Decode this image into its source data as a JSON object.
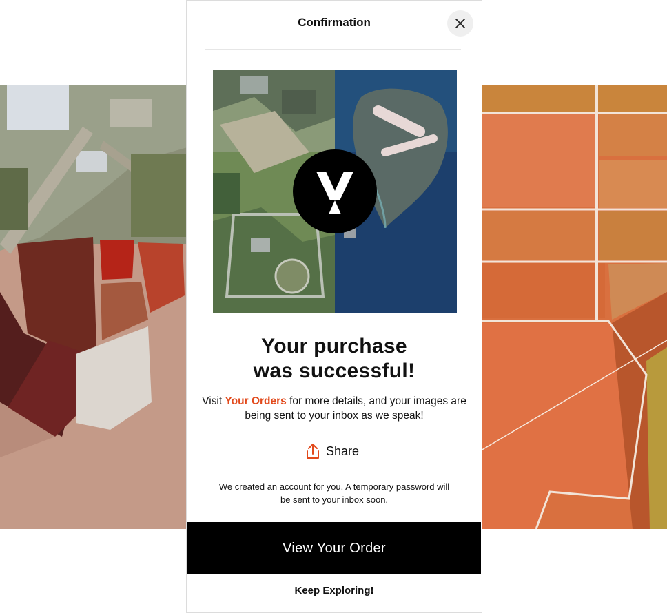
{
  "modal": {
    "title": "Confirmation",
    "close_icon": "close-icon",
    "hero_logo_icon": "brand-logo-icon",
    "headline_line1": "Your purchase",
    "headline_line2": "was successful!",
    "subtext_before": "Visit ",
    "subtext_link": "Your Orders",
    "subtext_after": " for more details, and your images are being sent to your inbox as we speak!",
    "share_icon": "share-icon",
    "share_label": "Share",
    "account_note": "We created an account for you. A temporary password will be sent to your inbox soon.",
    "primary_button": "View Your Order",
    "secondary_link": "Keep Exploring!"
  },
  "colors": {
    "accent": "#e24a1c",
    "primary_button_bg": "#000000",
    "text": "#111111"
  }
}
